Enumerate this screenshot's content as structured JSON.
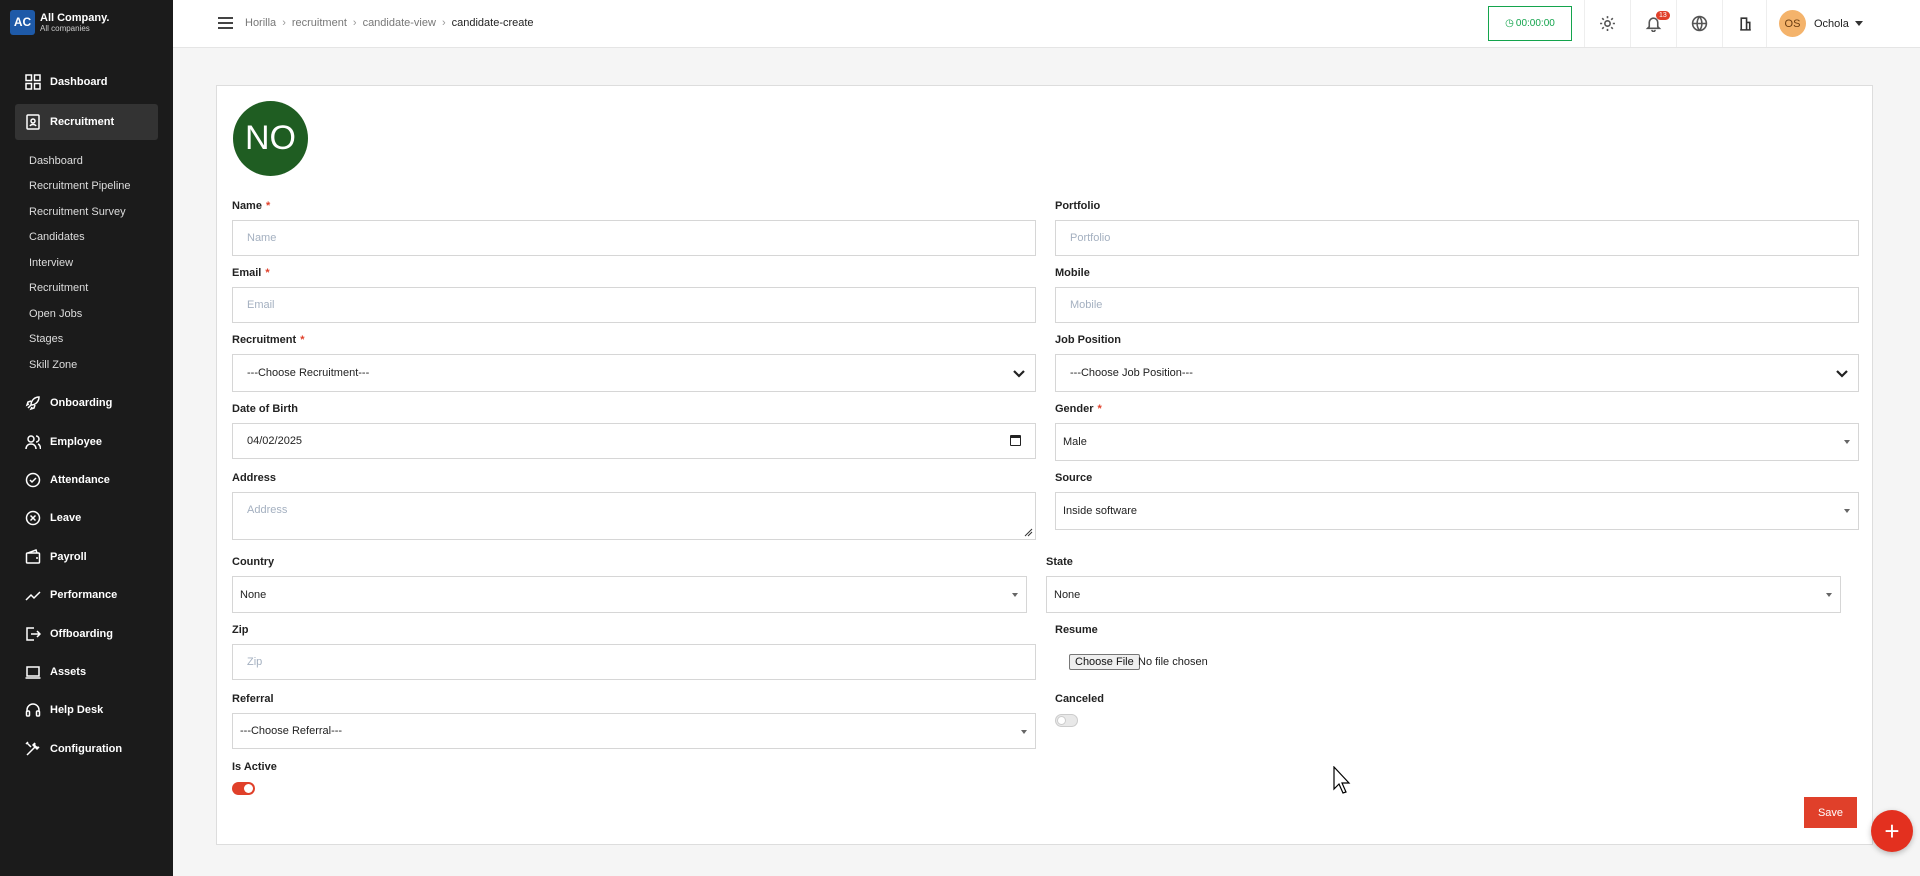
{
  "company": {
    "logo": "AC",
    "name": "All Company.",
    "sub": "All companies"
  },
  "sidebar": {
    "main": [
      {
        "label": "Dashboard",
        "icon": "dashboard-icon"
      },
      {
        "label": "Recruitment",
        "icon": "recruitment-icon",
        "active": true
      }
    ],
    "sub": [
      "Dashboard",
      "Recruitment Pipeline",
      "Recruitment Survey",
      "Candidates",
      "Interview",
      "Recruitment",
      "Open Jobs",
      "Stages",
      "Skill Zone"
    ],
    "rest": [
      {
        "label": "Onboarding",
        "icon": "rocket-icon"
      },
      {
        "label": "Employee",
        "icon": "users-icon"
      },
      {
        "label": "Attendance",
        "icon": "check-circle-icon"
      },
      {
        "label": "Leave",
        "icon": "x-circle-icon"
      },
      {
        "label": "Payroll",
        "icon": "wallet-icon"
      },
      {
        "label": "Performance",
        "icon": "trend-icon"
      },
      {
        "label": "Offboarding",
        "icon": "exit-icon"
      },
      {
        "label": "Assets",
        "icon": "laptop-icon"
      },
      {
        "label": "Help Desk",
        "icon": "headset-icon"
      },
      {
        "label": "Configuration",
        "icon": "tools-icon"
      }
    ]
  },
  "header": {
    "breadcrumb": [
      "Horilla",
      "recruitment",
      "candidate-view",
      "candidate-create"
    ],
    "timer": "00:00:00",
    "notification_count": "13",
    "user_initials": "OS",
    "user_name": "Ochola"
  },
  "form": {
    "avatar_initials": "NO",
    "name": {
      "label": "Name",
      "placeholder": "Name",
      "required": "*"
    },
    "portfolio": {
      "label": "Portfolio",
      "placeholder": "Portfolio"
    },
    "email": {
      "label": "Email",
      "placeholder": "Email",
      "required": "*"
    },
    "mobile": {
      "label": "Mobile",
      "placeholder": "Mobile"
    },
    "recruitment": {
      "label": "Recruitment",
      "value": "---Choose Recruitment---",
      "required": "*"
    },
    "job_position": {
      "label": "Job Position",
      "value": "---Choose Job Position---"
    },
    "dob": {
      "label": "Date of Birth",
      "value": "04/02/2025"
    },
    "gender": {
      "label": "Gender",
      "value": "Male",
      "required": "*"
    },
    "address": {
      "label": "Address",
      "placeholder": "Address"
    },
    "source": {
      "label": "Source",
      "value": "Inside software"
    },
    "country": {
      "label": "Country",
      "value": "None"
    },
    "state": {
      "label": "State",
      "value": "None"
    },
    "zip": {
      "label": "Zip",
      "placeholder": "Zip"
    },
    "resume": {
      "label": "Resume",
      "button": "Choose File",
      "status": "No file chosen"
    },
    "referral": {
      "label": "Referral",
      "value": "---Choose Referral---"
    },
    "canceled": {
      "label": "Canceled",
      "on": false
    },
    "is_active": {
      "label": "Is Active",
      "on": true
    },
    "save_label": "Save"
  },
  "fab_label": "+",
  "colors": {
    "accent": "#e0402a",
    "sidebar": "#1b1b1b",
    "timer": "#14a44d",
    "avatar": "#1f5d22"
  }
}
